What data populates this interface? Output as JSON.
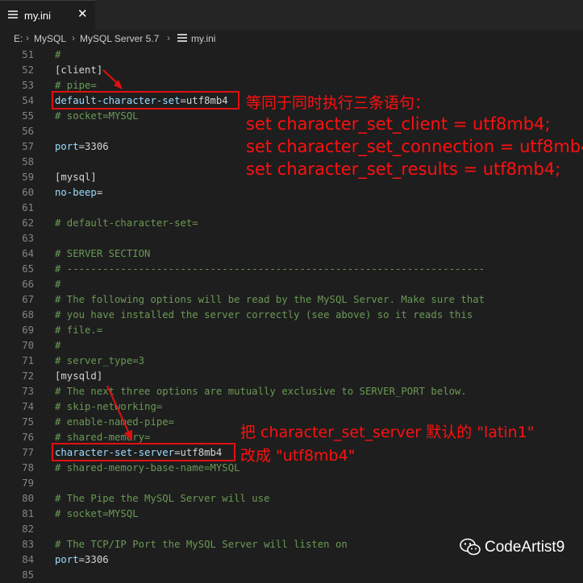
{
  "tab": {
    "label": "my.ini",
    "close": "✕"
  },
  "breadcrumb": {
    "items": [
      "E:",
      "MySQL",
      "MySQL Server 5.7",
      "my.ini"
    ],
    "sep": "›"
  },
  "colors": {
    "comment": "#6a9955",
    "key": "#9cdcfe",
    "text": "#d4d4d4",
    "annotation": "#ff1010"
  },
  "lines": [
    {
      "n": "51",
      "k": "",
      "v": "",
      "c": "#"
    },
    {
      "n": "52",
      "k": "",
      "v": "[client]",
      "c": ""
    },
    {
      "n": "53",
      "k": "",
      "v": "",
      "c": "# pipe="
    },
    {
      "n": "54",
      "k": "default-character-set",
      "v": "=utf8mb4",
      "c": ""
    },
    {
      "n": "55",
      "k": "",
      "v": "",
      "c": "# socket=MYSQL"
    },
    {
      "n": "56",
      "k": "",
      "v": "",
      "c": ""
    },
    {
      "n": "57",
      "k": "port",
      "v": "=3306",
      "c": ""
    },
    {
      "n": "58",
      "k": "",
      "v": "",
      "c": ""
    },
    {
      "n": "59",
      "k": "",
      "v": "[mysql]",
      "c": ""
    },
    {
      "n": "60",
      "k": "no-beep",
      "v": "=",
      "c": ""
    },
    {
      "n": "61",
      "k": "",
      "v": "",
      "c": ""
    },
    {
      "n": "62",
      "k": "",
      "v": "",
      "c": "# default-character-set="
    },
    {
      "n": "63",
      "k": "",
      "v": "",
      "c": ""
    },
    {
      "n": "64",
      "k": "",
      "v": "",
      "c": "# SERVER SECTION"
    },
    {
      "n": "65",
      "k": "",
      "v": "",
      "c": "# ----------------------------------------------------------------------"
    },
    {
      "n": "66",
      "k": "",
      "v": "",
      "c": "#"
    },
    {
      "n": "67",
      "k": "",
      "v": "",
      "c": "# The following options will be read by the MySQL Server. Make sure that"
    },
    {
      "n": "68",
      "k": "",
      "v": "",
      "c": "# you have installed the server correctly (see above) so it reads this"
    },
    {
      "n": "69",
      "k": "",
      "v": "",
      "c": "# file.="
    },
    {
      "n": "70",
      "k": "",
      "v": "",
      "c": "#"
    },
    {
      "n": "71",
      "k": "",
      "v": "",
      "c": "# server_type=3"
    },
    {
      "n": "72",
      "k": "",
      "v": "[mysqld]",
      "c": ""
    },
    {
      "n": "73",
      "k": "",
      "v": "",
      "c": "# The next three options are mutually exclusive to SERVER_PORT below."
    },
    {
      "n": "74",
      "k": "",
      "v": "",
      "c": "# skip-networking="
    },
    {
      "n": "75",
      "k": "",
      "v": "",
      "c": "# enable-named-pipe="
    },
    {
      "n": "76",
      "k": "",
      "v": "",
      "c": "# shared-memory="
    },
    {
      "n": "77",
      "k": "character-set-server",
      "v": "=utf8mb4",
      "c": ""
    },
    {
      "n": "78",
      "k": "",
      "v": "",
      "c": "# shared-memory-base-name=MYSQL"
    },
    {
      "n": "79",
      "k": "",
      "v": "",
      "c": ""
    },
    {
      "n": "80",
      "k": "",
      "v": "",
      "c": "# The Pipe the MySQL Server will use"
    },
    {
      "n": "81",
      "k": "",
      "v": "",
      "c": "# socket=MYSQL"
    },
    {
      "n": "82",
      "k": "",
      "v": "",
      "c": ""
    },
    {
      "n": "83",
      "k": "",
      "v": "",
      "c": "# The TCP/IP Port the MySQL Server will listen on"
    },
    {
      "n": "84",
      "k": "port",
      "v": "=3306",
      "c": ""
    },
    {
      "n": "85",
      "k": "",
      "v": "",
      "c": ""
    }
  ],
  "annotation1": {
    "title": "等同于同时执行三条语句：",
    "lines": [
      "set character_set_client = utf8mb4;",
      "set character_set_connection = utf8mb4;",
      "set character_set_results = utf8mb4;"
    ]
  },
  "annotation2": {
    "line1": "把 character_set_server 默认的 \"latin1\"",
    "line2": "改成 \"utf8mb4\""
  },
  "watermark": {
    "text": "CodeArtist9",
    "icon": "wechat-icon"
  }
}
